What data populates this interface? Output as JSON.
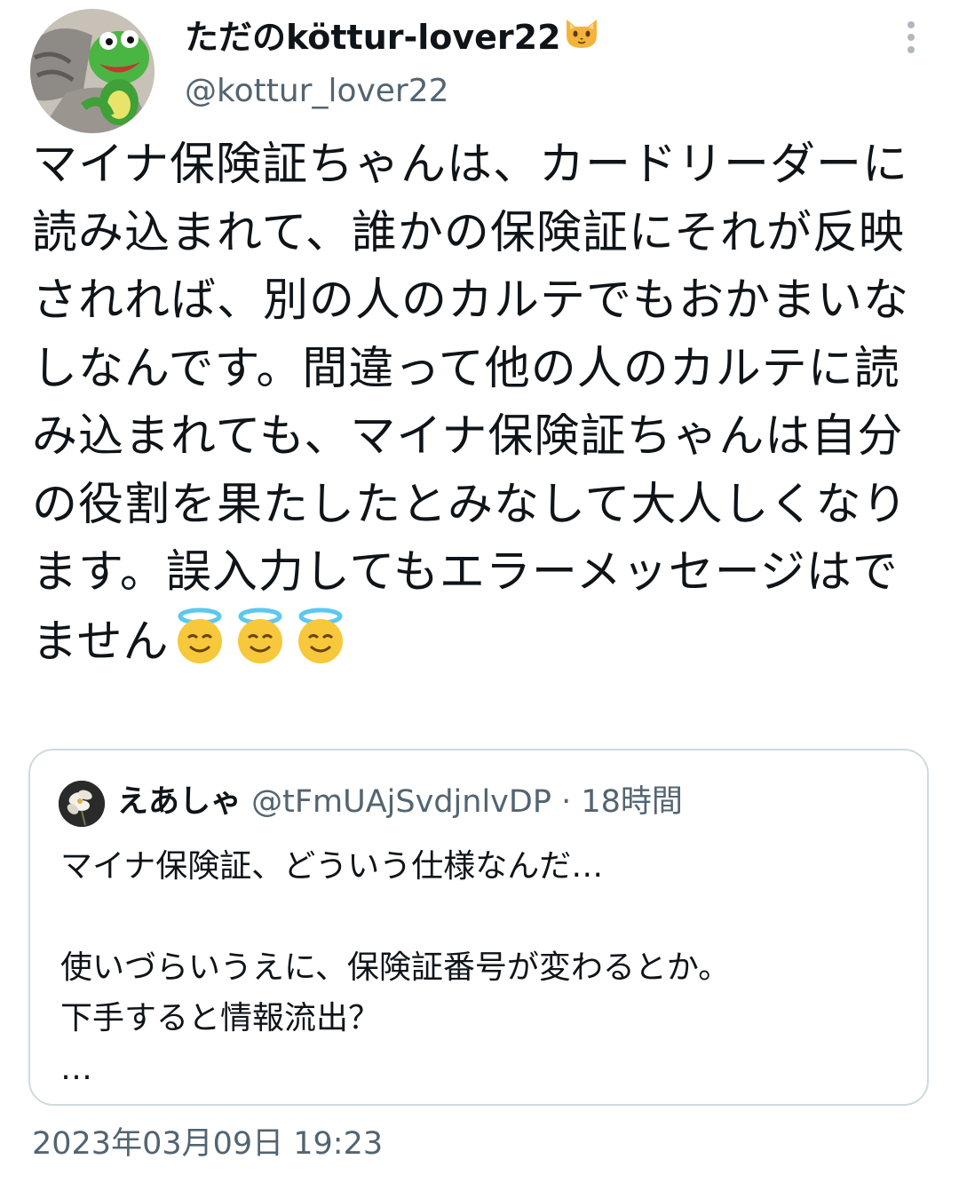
{
  "author": {
    "display_name": "ただのköttur-lover22",
    "display_name_emoji": "cat-face-icon",
    "handle": "@kottur_lover22"
  },
  "tweet": {
    "text": "マイナ保険証ちゃんは、カードリーダーに読み込まれて、誰かの保険証にそれが反映されれば、別の人のカルテでもおかまいなしなんです。間違って他の人のカルテに読み込まれても、マイナ保険証ちゃんは自分の役割を果たしたとみなして大人しくなります。誤入力してもエラーメッセージはでません",
    "trailing_emojis": [
      "smiling-face-with-halo-icon",
      "smiling-face-with-halo-icon",
      "smiling-face-with-halo-icon"
    ],
    "timestamp": "2023年03月09日 19:23"
  },
  "quoted_tweet": {
    "name": "えあしゃ",
    "handle": "@tFmUAjSvdjnlvDP",
    "separator": "·",
    "time": "18時間",
    "text": "マイナ保険証、どういう仕様なんだ…\n\n使いづらいうえに、保険証番号が変わるとか。\n下手すると情報流出？\n…"
  },
  "colors": {
    "text_primary": "#0f1419",
    "text_secondary": "#536471",
    "border": "#cfd9de",
    "more_icon": "#b0b8bf"
  }
}
